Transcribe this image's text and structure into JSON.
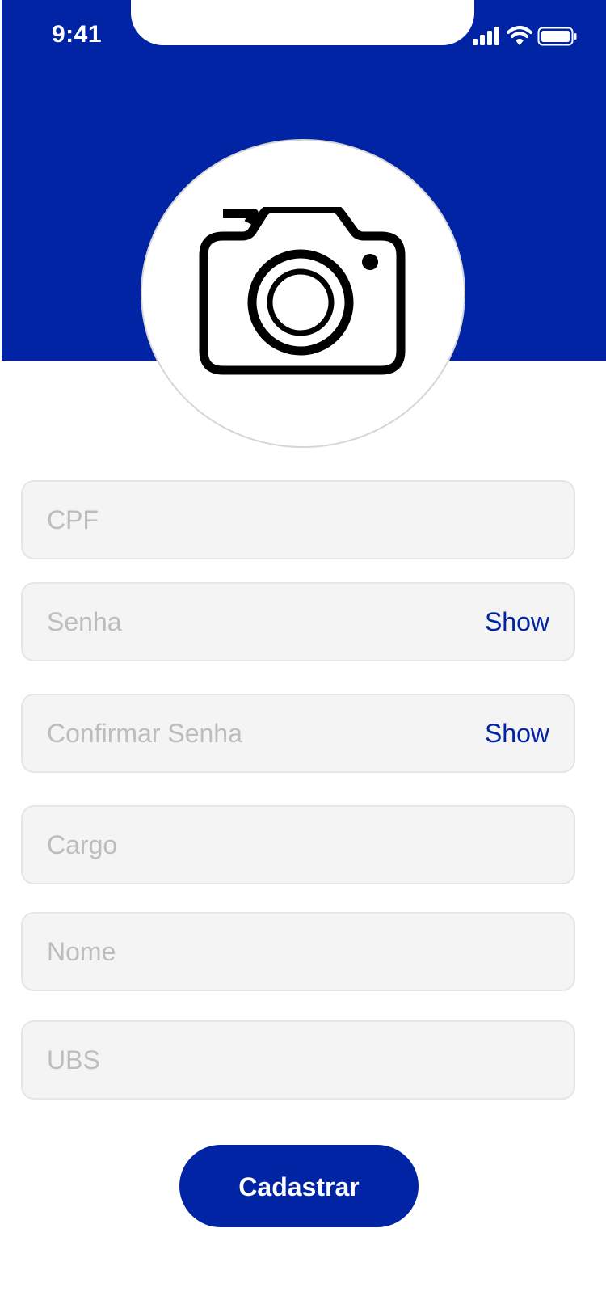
{
  "status_bar": {
    "time": "9:41",
    "icons": [
      "signal-icon",
      "wifi-icon",
      "battery-icon"
    ]
  },
  "profile_photo": {
    "icon": "camera-icon"
  },
  "form": {
    "cpf": {
      "placeholder": "CPF",
      "value": ""
    },
    "senha": {
      "placeholder": "Senha",
      "value": "",
      "toggle_label": "Show"
    },
    "confirmar_senha": {
      "placeholder": "Confirmar Senha",
      "value": "",
      "toggle_label": "Show"
    },
    "cargo": {
      "placeholder": "Cargo",
      "value": ""
    },
    "nome": {
      "placeholder": "Nome",
      "value": ""
    },
    "ubs": {
      "placeholder": "UBS",
      "value": ""
    },
    "submit_label": "Cadastrar"
  },
  "colors": {
    "primary": "#0024a3",
    "field_bg": "#f4f4f4",
    "placeholder": "#bdbdbd"
  }
}
